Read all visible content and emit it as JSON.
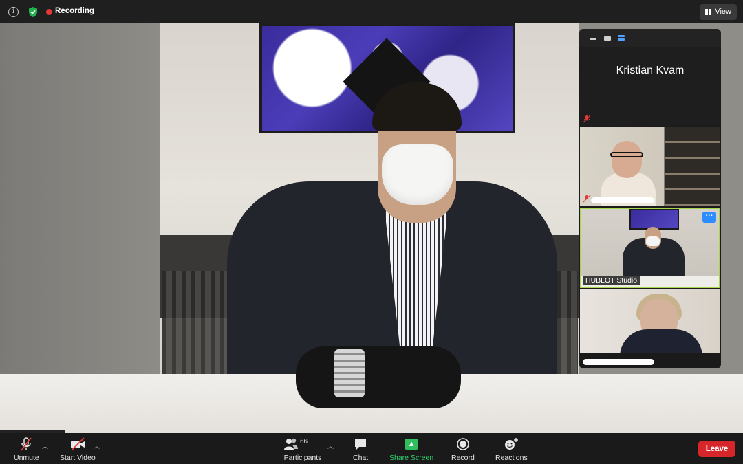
{
  "topbar": {
    "recording_label": "Recording",
    "view_label": "View"
  },
  "gallery": {
    "tiles": [
      {
        "name": "Kristian Kvam",
        "video": false,
        "muted": true
      },
      {
        "name": "",
        "video": true,
        "muted": true
      },
      {
        "name": "HUBLOT Studio",
        "video": true,
        "active_speaker": true
      },
      {
        "name": "",
        "video": true
      }
    ]
  },
  "toolbar": {
    "unmute_label": "Unmute",
    "start_video_label": "Start Video",
    "participants_label": "Participants",
    "participants_count": "66",
    "chat_label": "Chat",
    "share_label": "Share Screen",
    "record_label": "Record",
    "reactions_label": "Reactions",
    "leave_label": "Leave"
  },
  "colors": {
    "recording_dot": "#e53935",
    "share_green": "#2fd06b",
    "leave_red": "#d7262a",
    "active_border": "#a7d64a",
    "accent_blue": "#2d8cff"
  }
}
